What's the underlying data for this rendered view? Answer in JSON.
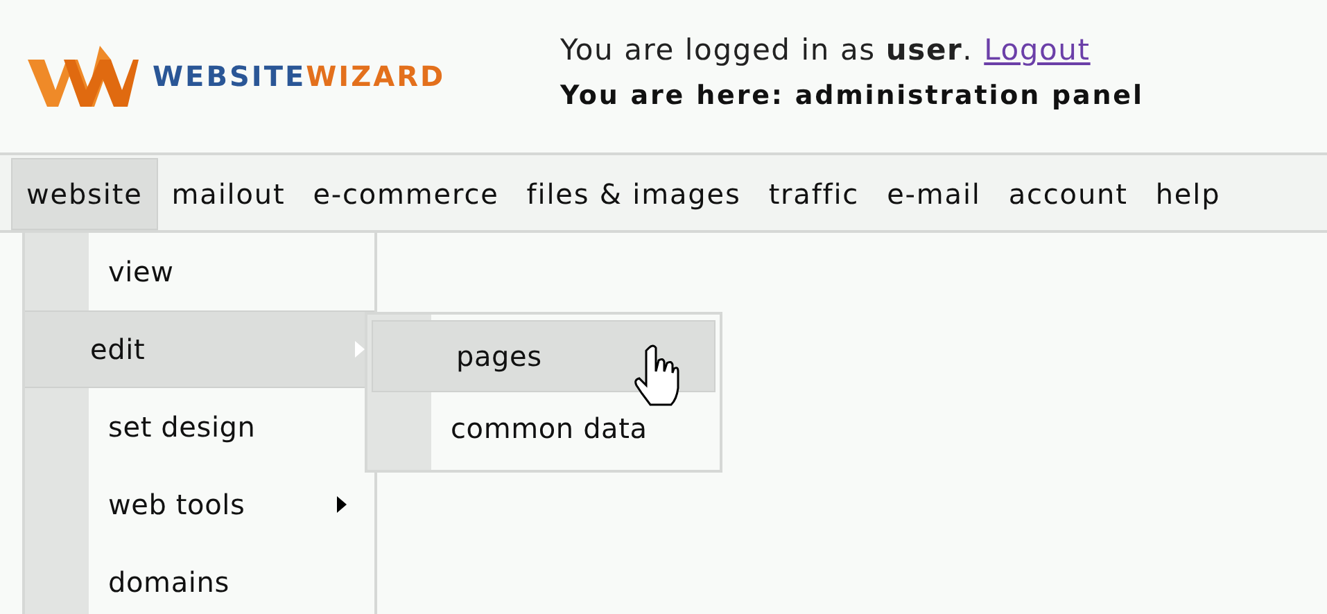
{
  "logo": [
    {
      "text": "WEBSITE",
      "color": "#2a5696"
    },
    {
      "text": "WIZARD",
      "color": "#e3701c"
    }
  ],
  "login": {
    "text": "You are logged in as **user**.",
    "link": "Logout"
  },
  "breadcrumb": "You are here: administration panel",
  "menubar": [
    {
      "label": "website",
      "selected": true
    },
    {
      "label": "mailout",
      "selected": false
    },
    {
      "label": "e-commerce",
      "selected": false
    },
    {
      "label": "files & images",
      "selected": false
    },
    {
      "label": "traffic",
      "selected": false
    },
    {
      "label": "e-mail",
      "selected": false
    },
    {
      "label": "account",
      "selected": false
    },
    {
      "label": "help",
      "selected": false
    }
  ],
  "dropdown": [
    {
      "label": "view",
      "selected": false,
      "submenu": false
    },
    {
      "label": "edit",
      "selected": true,
      "submenu": true
    },
    {
      "label": "set design",
      "selected": false,
      "submenu": false
    },
    {
      "label": "web tools",
      "selected": false,
      "submenu": true
    },
    {
      "label": "domains",
      "selected": false,
      "submenu": false
    }
  ],
  "submenu": [
    {
      "label": "pages",
      "selected": true
    },
    {
      "label": "common data",
      "selected": false
    }
  ]
}
